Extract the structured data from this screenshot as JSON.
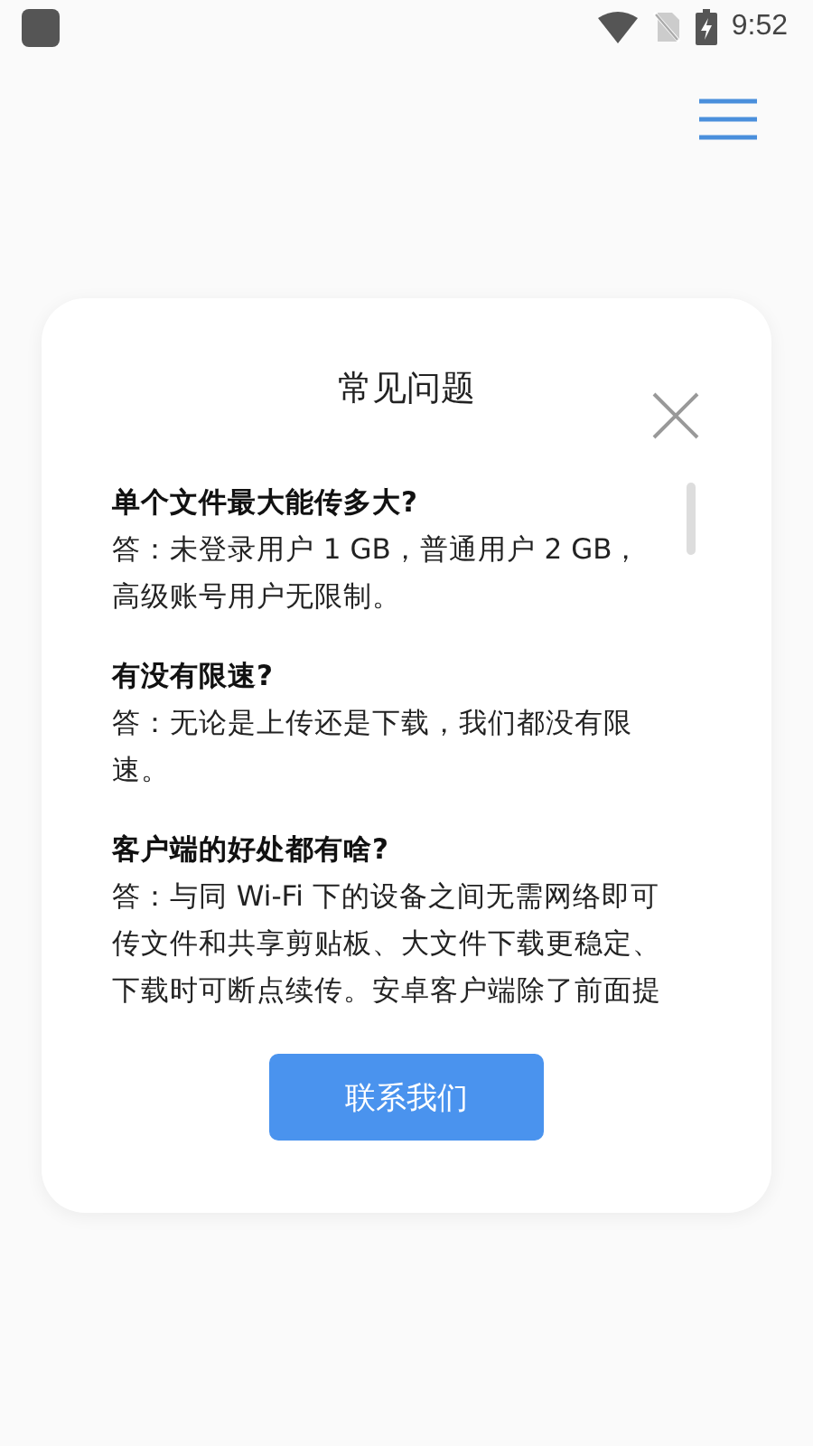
{
  "status_bar": {
    "time": "9:52"
  },
  "dialog": {
    "title": "常见问题",
    "faq": [
      {
        "question": "单个文件最大能传多大?",
        "answer": "答：未登录用户 1 GB，普通用户 2 GB，高级账号用户无限制。"
      },
      {
        "question": "有没有限速?",
        "answer": "答：无论是上传还是下载，我们都没有限速。"
      },
      {
        "question": "客户端的好处都有啥?",
        "answer": "答：与同 Wi-Fi 下的设备之间无需网络即可传文件和共享剪贴板、大文件下载更稳定、下载时可断点续传。安卓客户端除了前面提"
      }
    ],
    "button": "联系我们"
  }
}
